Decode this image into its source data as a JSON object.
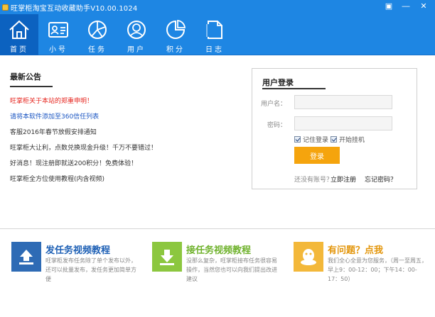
{
  "titlebar": {
    "title": "旺掌柜淘宝互动收藏助手V10.00.1024",
    "buttons": [
      "▣",
      "—",
      "✕"
    ]
  },
  "nav": [
    {
      "label": "首页",
      "icon": "home-icon",
      "active": true
    },
    {
      "label": "小号",
      "icon": "id-card-icon",
      "active": false
    },
    {
      "label": "任务",
      "icon": "pie-chart-icon",
      "active": false
    },
    {
      "label": "用户",
      "icon": "user-icon",
      "active": false
    },
    {
      "label": "积分",
      "icon": "donut-chart-icon",
      "active": false
    },
    {
      "label": "日志",
      "icon": "document-icon",
      "active": false
    }
  ],
  "notices": {
    "heading": "最新公告",
    "items": [
      {
        "text": "旺掌柜关于本站的郑重申明！",
        "color": "red"
      },
      {
        "text": "请将本软件添加至360信任列表",
        "color": "blue"
      },
      {
        "text": "客服2016年春节放假安排通知",
        "color": "dark"
      },
      {
        "text": "旺掌柜大让利，点数兑换现金升级！千万不要错过！",
        "color": "dark"
      },
      {
        "text": "好消息！现注册即就送200积分！免费体验！",
        "color": "dark"
      },
      {
        "text": "旺掌柜全方位使用教程(内含视频)",
        "color": "dark"
      }
    ]
  },
  "login": {
    "heading": "用户登录",
    "username_label": "用户名：",
    "username_value": "",
    "password_label": "密码：",
    "password_value": "",
    "remember_label": "记住登录",
    "autostart_label": "开始挂机",
    "login_button": "登录",
    "no_account_text": "还没有账号？",
    "register_link": "立即注册",
    "forgot_link": "忘记密码？"
  },
  "promos": [
    {
      "title": "发任务视频教程",
      "desc": "旺掌柜发布任务除了单个发布以外，还可以批量发布，发任务更加简单方便",
      "color": "#2e6bb5",
      "title_color": "#1e60b5",
      "icon": "upload-icon"
    },
    {
      "title": "接任务视频教程",
      "desc": "没那么复杂，旺掌柜接布任务很容易操作，当然您也可以向我们提出改进建议",
      "color": "#8cc73f",
      "title_color": "#6fb22c",
      "icon": "download-icon"
    },
    {
      "title": "有问题？点我",
      "desc": "我们全心全意为您服务，（周一至周五，早上9：00-12：00；下午14：00-17：50）",
      "color": "#f3b83a",
      "title_color": "#e3960c",
      "icon": "chat-penguin-icon"
    }
  ]
}
